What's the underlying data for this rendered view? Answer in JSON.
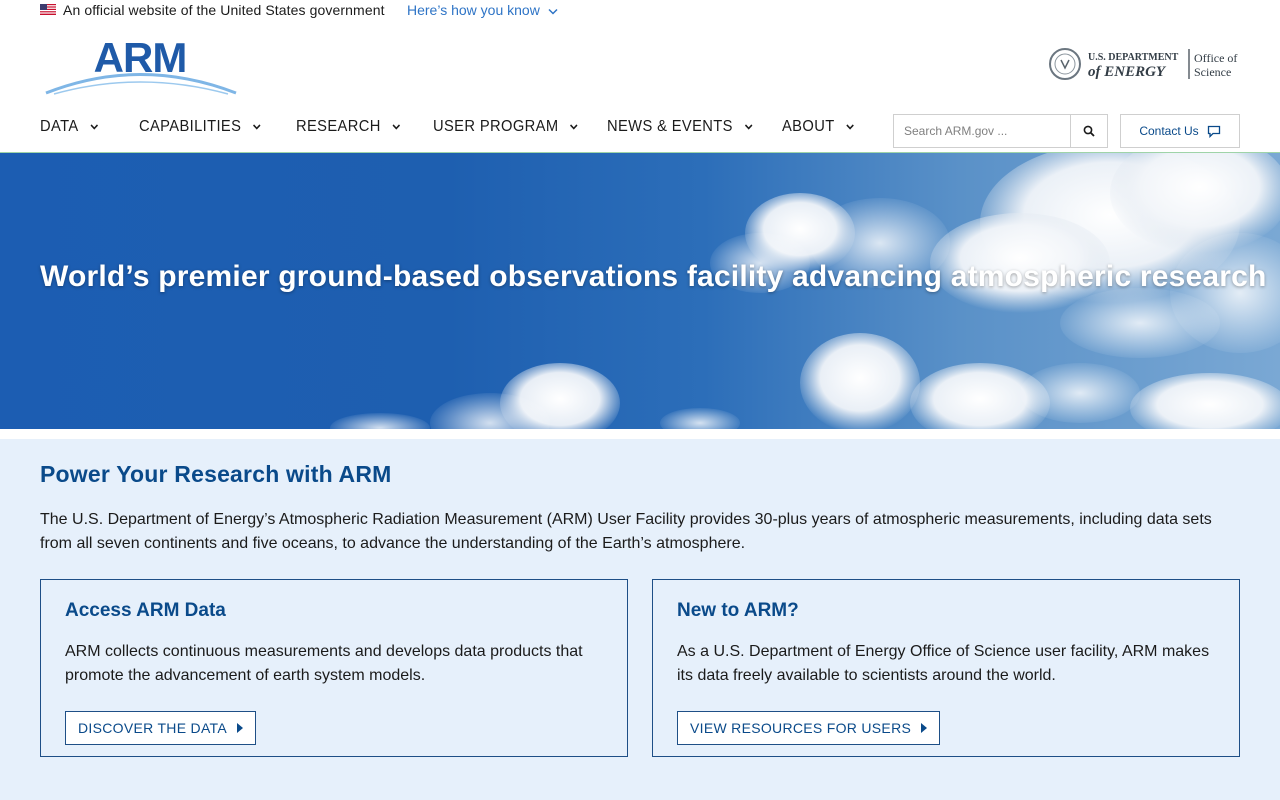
{
  "gov_banner": {
    "text": "An official website of the United States government",
    "link": "Here’s how you know"
  },
  "header": {
    "logo_text": "ARM",
    "doe_line1": "U.S. DEPARTMENT",
    "doe_line2": "of ENERGY",
    "doe_office1": "Office of",
    "doe_office2": "Science"
  },
  "nav": {
    "items": [
      {
        "label": "DATA"
      },
      {
        "label": "CAPABILITIES"
      },
      {
        "label": "RESEARCH"
      },
      {
        "label": "USER PROGRAM"
      },
      {
        "label": "NEWS & EVENTS"
      },
      {
        "label": "ABOUT"
      }
    ],
    "search_placeholder": "Search ARM.gov ...",
    "contact_label": "Contact Us"
  },
  "hero": {
    "title": "World’s premier ground-based observations facility advancing atmospheric research"
  },
  "intro": {
    "title": "Power Your Research with ARM",
    "description": "The U.S. Department of Energy’s Atmospheric Radiation Measurement (ARM) User Facility provides 30-plus years of atmospheric measurements, including data sets from all seven continents and five oceans, to advance the understanding of the Earth’s atmosphere."
  },
  "cards": [
    {
      "title": "Access ARM Data",
      "text": "ARM collects continuous measurements and develops data products that promote the advancement of earth system models.",
      "button": "DISCOVER THE DATA"
    },
    {
      "title": "New to ARM?",
      "text": "As a U.S. Department of Energy Office of Science user facility, ARM makes its data freely available to scientists around the world.",
      "button": "VIEW RESOURCES FOR USERS"
    }
  ],
  "colors": {
    "brand_blue": "#0a4a8a",
    "link_blue": "#2e74c6",
    "section_bg": "#e6f0fb",
    "nav_border": "#9fd4a8"
  }
}
